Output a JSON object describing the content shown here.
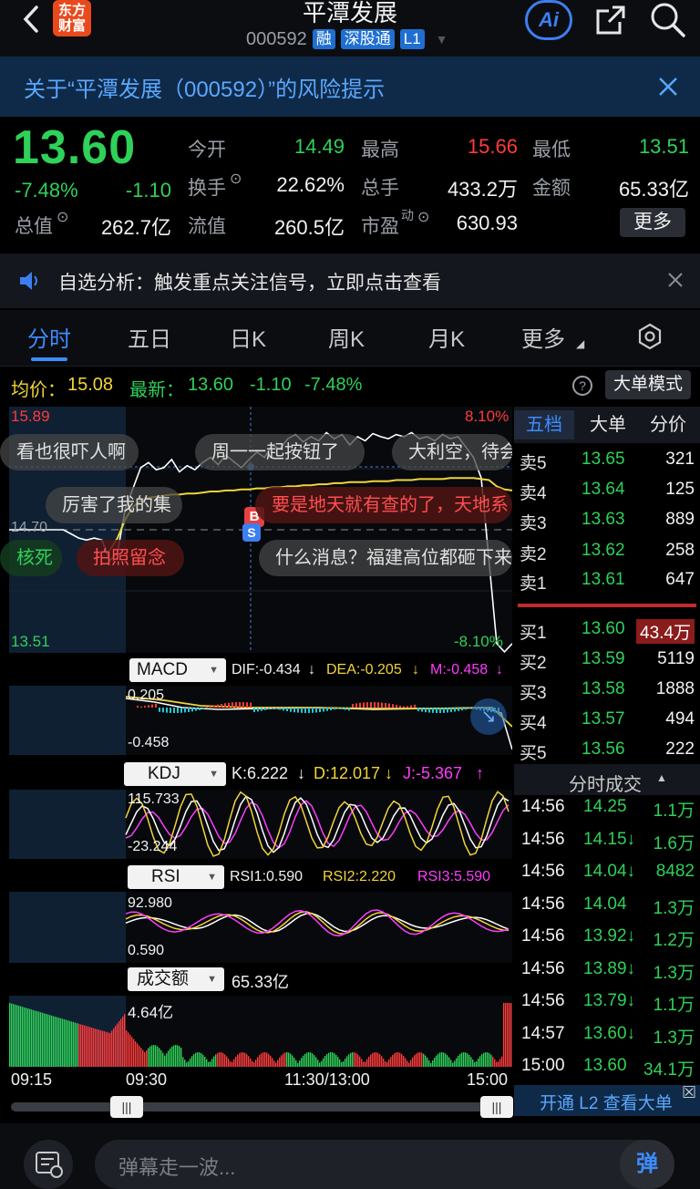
{
  "header": {
    "title": "平潭发展",
    "code": "000592",
    "tags": [
      "融",
      "深股通",
      "L1"
    ],
    "logo_line1": "东方",
    "logo_line2": "财富",
    "ai_label": "Ai"
  },
  "risk_banner": {
    "text": "关于“平潭发展（000592）”的风险提示"
  },
  "quote": {
    "price": "13.60",
    "change_pct": "-7.48%",
    "change": "-1.10",
    "fields": [
      {
        "label": "今开",
        "value": "14.49",
        "color": "#2fd158"
      },
      {
        "label": "最高",
        "value": "15.66",
        "color": "#ff3b3b"
      },
      {
        "label": "最低",
        "value": "13.51",
        "color": "#2fd158"
      },
      {
        "label": "换手",
        "value": "22.62%",
        "color": "#f2f2f2"
      },
      {
        "label": "总手",
        "value": "433.2万",
        "color": "#f2f2f2"
      },
      {
        "label": "金额",
        "value": "65.33亿",
        "color": "#f2f2f2"
      },
      {
        "label": "总值",
        "value": "262.7亿",
        "color": "#f2f2f2"
      },
      {
        "label": "流值",
        "value": "260.5亿",
        "color": "#f2f2f2"
      },
      {
        "label": "市盈",
        "value": "630.93",
        "color": "#f2f2f2",
        "superscript": "动"
      }
    ],
    "more_label": "更多"
  },
  "signal": {
    "text": "自选分析：触发重点关注信号，立即点击查看"
  },
  "tabs": {
    "items": [
      "分时",
      "五日",
      "日K",
      "周K",
      "月K",
      "更多"
    ],
    "active": 0
  },
  "chart_info": {
    "avg_label": "均价：",
    "avg_value": "15.08",
    "latest_label": "最新：",
    "latest_value": "13.60",
    "latest_change": "-1.10",
    "latest_pct": "-7.48%",
    "big_order_label": "大单模式"
  },
  "chart_data": {
    "type": "line",
    "price_axis": {
      "top": "15.89",
      "mid": "14.70",
      "bottom": "13.51",
      "pct_top": "8.10%",
      "pct_bottom": "-8.10%"
    },
    "time_labels": [
      "09:15",
      "09:30",
      "11:30/13:00",
      "15:00"
    ],
    "price_series": [
      14.7,
      14.7,
      14.7,
      14.7,
      14.7,
      14.7,
      14.7,
      14.7,
      14.66,
      14.62,
      14.6,
      14.62,
      14.6,
      14.4,
      14.48,
      14.9,
      15.1,
      15.3,
      15.35,
      15.28,
      15.3,
      15.38,
      15.26,
      15.32,
      15.28,
      15.35,
      15.4,
      15.33,
      15.42,
      15.36,
      15.3,
      15.38,
      15.45,
      15.4,
      15.52,
      15.48,
      15.58,
      15.62,
      15.55,
      15.6,
      15.56,
      15.64,
      15.58,
      15.62,
      15.52,
      15.6,
      15.56,
      15.63,
      15.6,
      15.58,
      15.62,
      15.6,
      15.64,
      15.58,
      15.6,
      15.56,
      15.62,
      15.58,
      15.6,
      15.5,
      15.4,
      15.2,
      14.4,
      13.6,
      13.52,
      13.6
    ],
    "avg_series": [
      null,
      null,
      null,
      null,
      null,
      null,
      null,
      null,
      null,
      null,
      null,
      null,
      null,
      14.5,
      14.62,
      14.8,
      14.92,
      14.98,
      15.01,
      15.02,
      15.03,
      15.04,
      15.04,
      15.05,
      15.05,
      15.06,
      15.07,
      15.07,
      15.08,
      15.08,
      15.09,
      15.09,
      15.1,
      15.1,
      15.11,
      15.11,
      15.12,
      15.12,
      15.13,
      15.13,
      15.14,
      15.14,
      15.15,
      15.15,
      15.16,
      15.16,
      15.16,
      15.17,
      15.17,
      15.17,
      15.18,
      15.18,
      15.18,
      15.19,
      15.19,
      15.19,
      15.19,
      15.2,
      15.2,
      15.2,
      15.2,
      15.19,
      15.18,
      15.12,
      15.09,
      15.08
    ],
    "macd": {
      "label": "MACD",
      "dif": "DIF:-0.434",
      "dea": "DEA:-0.205",
      "m": "M:-0.458",
      "axis_top": "0.205",
      "axis_bottom": "-0.458"
    },
    "kdj": {
      "label": "KDJ",
      "k": "K:6.222",
      "d": "D:12.017",
      "j": "J:-5.367",
      "axis_top": "115.733",
      "axis_bottom": "-23.244"
    },
    "rsi": {
      "label": "RSI",
      "rsi1": "RSI1:0.590",
      "rsi2": "RSI2:2.220",
      "rsi3": "RSI3:5.590",
      "axis_top": "92.980",
      "axis_bottom": "0.590"
    },
    "volume": {
      "label": "成交额",
      "total": "65.33亿",
      "axis_top": "4.64亿"
    }
  },
  "danmu": [
    "看也很吓人啊",
    "周一一起按钮了",
    "大利空，待会",
    "厉害了我的集",
    "要是地天就有查的了，天地系",
    "核死",
    "拍照留念",
    "什么消息？福建高位都砸下来"
  ],
  "order_book": {
    "tabs": [
      "五档",
      "大单",
      "分价"
    ],
    "asks": [
      {
        "label": "卖5",
        "price": "13.65",
        "vol": "321"
      },
      {
        "label": "卖4",
        "price": "13.64",
        "vol": "125"
      },
      {
        "label": "卖3",
        "price": "13.63",
        "vol": "889"
      },
      {
        "label": "卖2",
        "price": "13.62",
        "vol": "258"
      },
      {
        "label": "卖1",
        "price": "13.61",
        "vol": "647"
      }
    ],
    "bids": [
      {
        "label": "买1",
        "price": "13.60",
        "vol": "43.4万"
      },
      {
        "label": "买2",
        "price": "13.59",
        "vol": "5119"
      },
      {
        "label": "买3",
        "price": "13.58",
        "vol": "1888"
      },
      {
        "label": "买4",
        "price": "13.57",
        "vol": "494"
      },
      {
        "label": "买5",
        "price": "13.56",
        "vol": "222"
      }
    ]
  },
  "trades": {
    "title": "分时成交",
    "rows": [
      {
        "time": "14:56",
        "price": "14.25",
        "vol": "1.1万"
      },
      {
        "time": "14:56",
        "price": "14.15↓",
        "vol": "1.6万"
      },
      {
        "time": "14:56",
        "price": "14.04↓",
        "vol": "8482"
      },
      {
        "time": "14:56",
        "price": "14.04",
        "vol": "1.3万"
      },
      {
        "time": "14:56",
        "price": "13.92↓",
        "vol": "1.2万"
      },
      {
        "time": "14:56",
        "price": "13.89↓",
        "vol": "1.3万"
      },
      {
        "time": "14:56",
        "price": "13.79↓",
        "vol": "1.1万"
      },
      {
        "time": "14:57",
        "price": "13.60↓",
        "vol": "1.3万"
      },
      {
        "time": "15:00",
        "price": "13.60",
        "vol": "34.1万"
      }
    ],
    "l2_label": "开通 L2 查看大单"
  },
  "bottom": {
    "placeholder": "弹幕走一波...",
    "send_label": "弹"
  }
}
